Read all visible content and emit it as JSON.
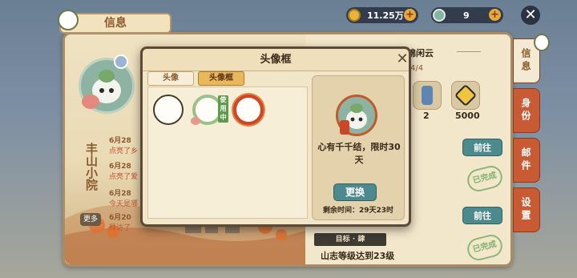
{
  "currency": {
    "gold": {
      "value": "11.25万",
      "icon": "gold-coin-icon"
    },
    "jade": {
      "value": "9",
      "icon": "jade-coin-icon"
    }
  },
  "main_window": {
    "title": "信息",
    "name_vertical": "丰山小院",
    "more_label": "更多",
    "logs": [
      {
        "date": "6月28",
        "text": "点亮了乡"
      },
      {
        "date": "6月28",
        "text": "点亮了爱"
      },
      {
        "date": "6月28",
        "text": "今天是哪"
      },
      {
        "date": "6月20",
        "text": "拜访了"
      }
    ]
  },
  "right_panel": {
    "friend_name": "锦闲云",
    "progress": "4/4",
    "items": [
      {
        "icon": "scroll-icon",
        "count": "2"
      },
      {
        "icon": "coin-icon",
        "count": "5000"
      }
    ],
    "go_label": "前往",
    "claimed_stamp": "已完成",
    "goal_label": "目标 · 肆",
    "goal_text": "山志等级达到23级"
  },
  "side_tabs": [
    "信息",
    "身份",
    "邮件",
    "设置"
  ],
  "modal": {
    "title": "头像框",
    "tabs": [
      "头像",
      "头像框"
    ],
    "active_tab": "头像框",
    "in_use_tag": "使用中",
    "frames": [
      {
        "style": "plain",
        "in_use": false
      },
      {
        "style": "floral-green",
        "in_use": true
      },
      {
        "style": "knot-red",
        "in_use": false
      }
    ],
    "preview_desc": "心有千千结，限时30天",
    "change_button": "更换",
    "remaining": "剩余时间：29天23时"
  },
  "colors": {
    "accent_teal": "#4d8a8e",
    "tab_orange": "#c85b33",
    "panel_cream": "#f3e7cb"
  }
}
